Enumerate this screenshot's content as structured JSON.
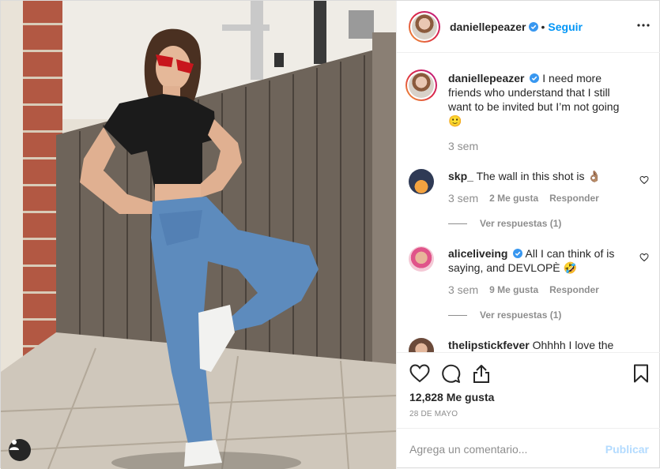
{
  "post": {
    "author": "daniellepeazer",
    "follow_label": "Seguir",
    "separator": "•",
    "caption": {
      "username": "daniellepeazer",
      "text": "I need more friends who understand that I still want to be invited but I’m not going 🙂",
      "time": "3 sem"
    },
    "comments": [
      {
        "username": "skp_",
        "text": "The wall in this shot is 👌🏽",
        "time": "3 sem",
        "likes": "2 Me gusta",
        "reply_label": "Responder",
        "replies_label": "Ver respuestas (1)",
        "avatar_color": "#c07a3a"
      },
      {
        "username": "aliceliveing",
        "text": "All I can think of is saying, and DEVLOPÈ 🤣",
        "time": "3 sem",
        "likes": "9 Me gusta",
        "reply_label": "Responder",
        "replies_label": "Ver respuestas (1)",
        "avatar_color": "#e8b59a",
        "verified": true
      },
      {
        "username": "thelipstickfever",
        "text": "Ohhhh I love the",
        "avatar_color": "#b08978"
      }
    ],
    "likes": "12,828 Me gusta",
    "date": "28 DE MAYO",
    "comment_placeholder": "Agrega un comentario...",
    "publish_label": "Publicar"
  },
  "colors": {
    "link": "#0095f6",
    "muted": "#8e8e8e",
    "publish_disabled": "#b3dbff",
    "verified": "#3897f0"
  },
  "icons": [
    "verified-badge-icon",
    "more-options-icon",
    "heart-icon",
    "comment-icon",
    "share-icon",
    "bookmark-icon",
    "user-tag-icon"
  ]
}
